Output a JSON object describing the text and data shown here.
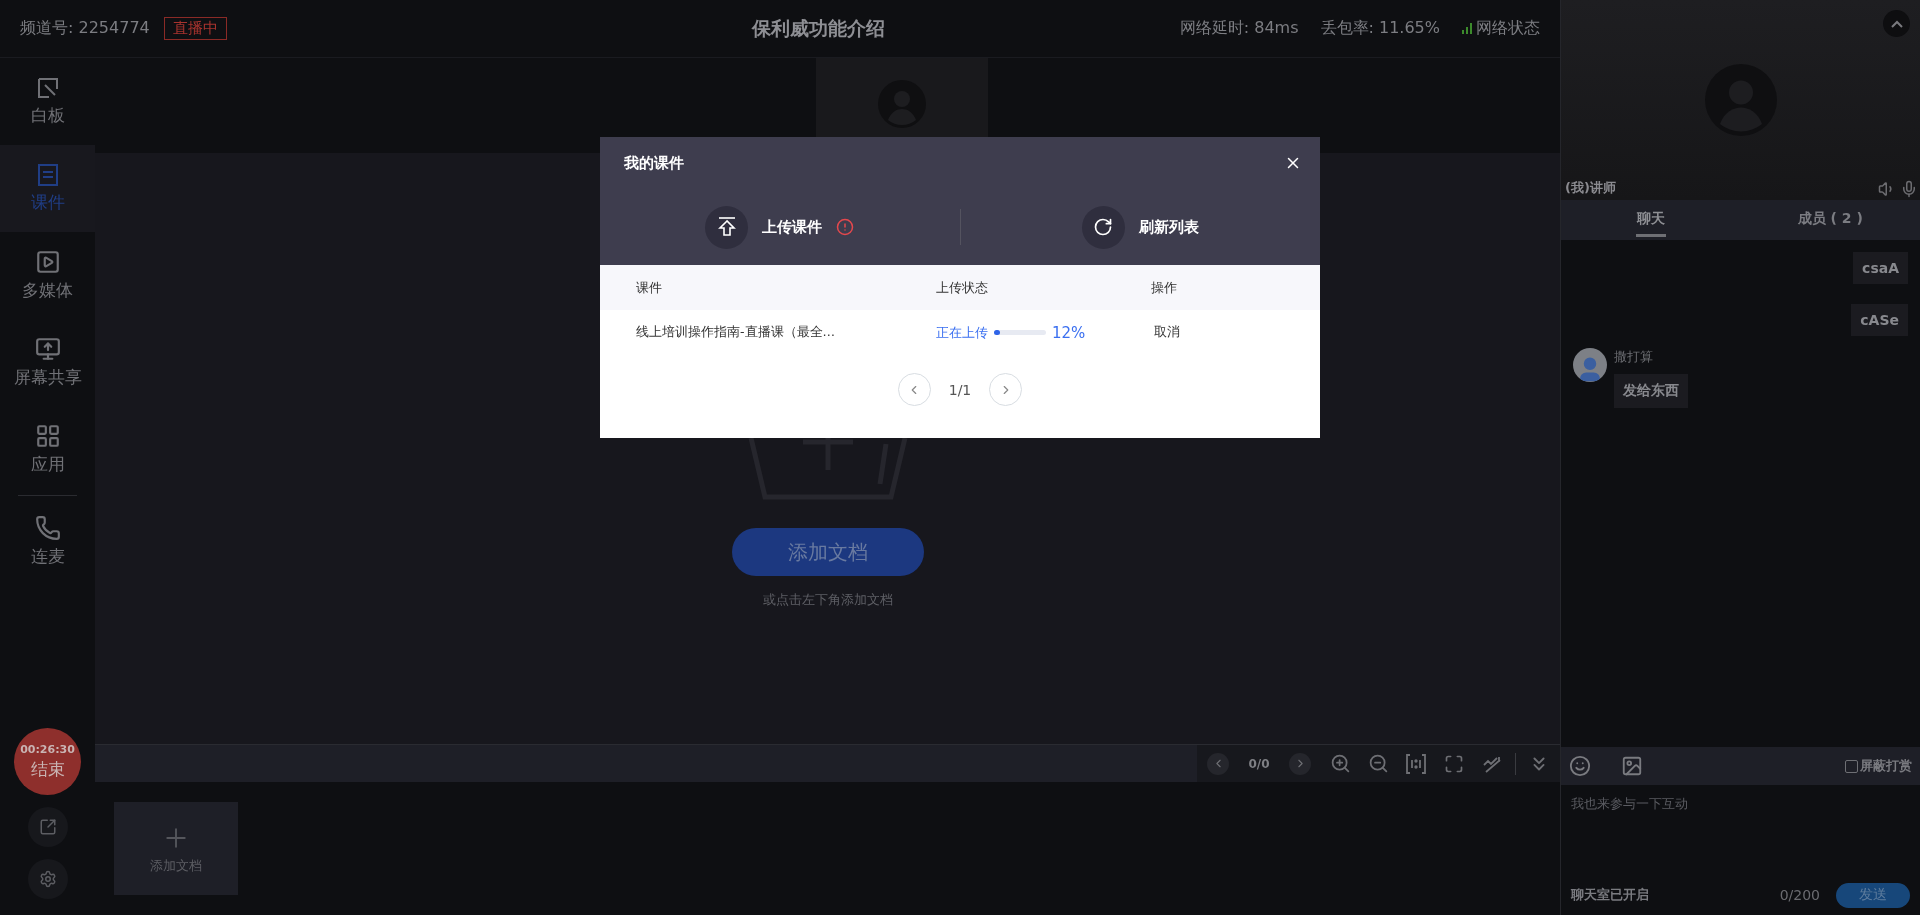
{
  "header": {
    "channel": "频道号: 2254774",
    "live_badge": "直播中",
    "title": "保利威功能介绍",
    "latency": "网络延时: 84ms",
    "packet_loss": "丢包率: 11.65%",
    "network_status": "网络状态"
  },
  "sidebar": {
    "items": [
      {
        "label": "白板",
        "selected": false
      },
      {
        "label": "课件",
        "selected": true
      },
      {
        "label": "多媒体",
        "selected": false
      },
      {
        "label": "屏幕共享",
        "selected": false
      },
      {
        "label": "应用",
        "selected": false
      },
      {
        "label": "连麦",
        "selected": false
      }
    ],
    "timer": "00:26:30",
    "end_label": "结束"
  },
  "stage": {
    "add_button": "添加文档",
    "hint": "或点击左下角添加文档"
  },
  "toolbar": {
    "page": "0/0"
  },
  "thumbnails": {
    "add_label": "添加文档"
  },
  "modal": {
    "title": "我的课件",
    "actions": [
      {
        "label": "上传课件",
        "kind": "upload",
        "warning": true
      },
      {
        "label": "刷新列表",
        "kind": "refresh",
        "warning": false
      }
    ],
    "columns": [
      "课件",
      "上传状态",
      "操作"
    ],
    "rows": [
      {
        "name": "线上培训操作指南-直播课（最全…",
        "status": "正在上传",
        "level": 0.12,
        "percent": "12%",
        "action": "取消"
      }
    ],
    "pagination": "1/1"
  },
  "video": {
    "name": "(我)讲师"
  },
  "chat": {
    "tabs": [
      {
        "label": "聊天",
        "selected": true
      },
      {
        "label": "成员 ( 2 )",
        "selected": false
      }
    ],
    "messages": [
      {
        "kind": "mine",
        "text": "csaA"
      },
      {
        "kind": "mine",
        "text": "cASe"
      },
      {
        "kind": "other",
        "sender": "撒打算",
        "text": "发给东西"
      }
    ],
    "block_rewards": {
      "label": "屏蔽打赏",
      "checked": false
    },
    "placeholder": "我也来参与一下互动",
    "status": "聊天室已开启",
    "count": "0/200",
    "send": "发送"
  }
}
